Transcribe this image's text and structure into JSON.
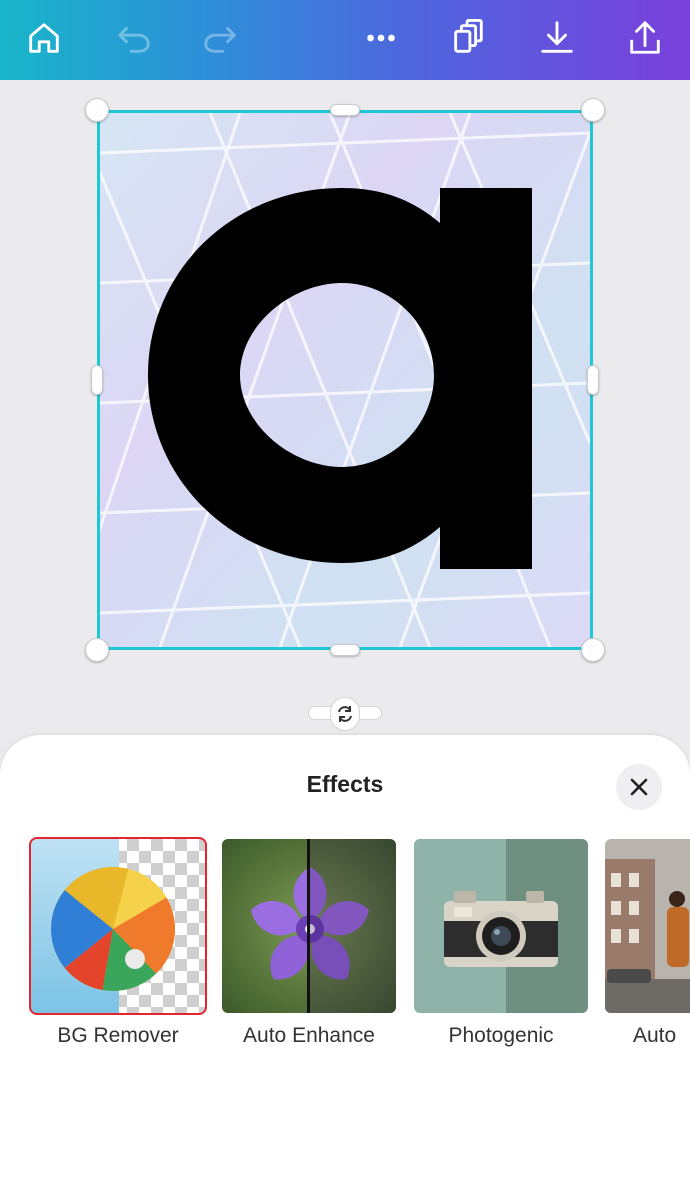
{
  "toolbar": {
    "buttons": [
      {
        "name": "home-button",
        "icon": "home-icon"
      },
      {
        "name": "undo-button",
        "icon": "undo-icon",
        "disabled": true
      },
      {
        "name": "redo-button",
        "icon": "redo-icon",
        "disabled": true
      },
      {
        "name": "more-options-button",
        "icon": "ellipsis-icon"
      },
      {
        "name": "duplicate-button",
        "icon": "copy-pages-icon"
      },
      {
        "name": "download-button",
        "icon": "download-icon"
      },
      {
        "name": "share-button",
        "icon": "share-upload-icon"
      }
    ]
  },
  "canvas": {
    "element": "letter a graphic on geometric pastel background",
    "selection_color": "#1fc6d6"
  },
  "effects_panel": {
    "title": "Effects",
    "close_icon": "close-icon",
    "items": [
      {
        "label": "BG Remover",
        "selected": true
      },
      {
        "label": "Auto Enhance",
        "selected": false
      },
      {
        "label": "Photogenic",
        "selected": false
      },
      {
        "label": "Auto",
        "selected": false
      }
    ],
    "selected_color": "#e3262d"
  }
}
